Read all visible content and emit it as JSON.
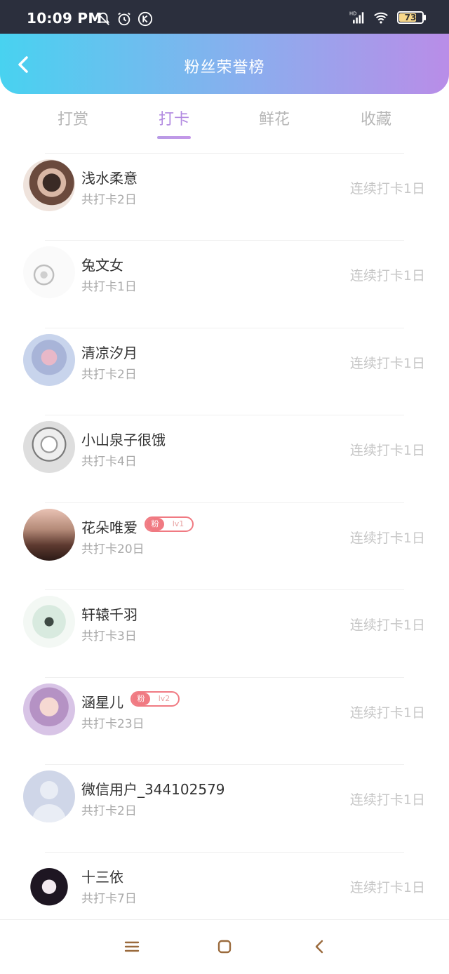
{
  "status_bar": {
    "time": "10:09 PM",
    "hd": "HD",
    "battery": "73"
  },
  "header": {
    "title": "粉丝荣誉榜"
  },
  "tabs": [
    {
      "label": "打赏"
    },
    {
      "label": "打卡"
    },
    {
      "label": "鲜花"
    },
    {
      "label": "收藏"
    }
  ],
  "active_tab": 1,
  "rows": [
    {
      "name": "浅水柔意",
      "count": "共打卡2日",
      "streak": "连续打卡1日"
    },
    {
      "name": "兔文女",
      "count": "共打卡1日",
      "streak": "连续打卡1日"
    },
    {
      "name": "清凉汐月",
      "count": "共打卡2日",
      "streak": "连续打卡1日"
    },
    {
      "name": "小山泉子很饿",
      "count": "共打卡4日",
      "streak": "连续打卡1日"
    },
    {
      "name": "花朵唯爱",
      "count": "共打卡20日",
      "streak": "连续打卡1日",
      "badge": {
        "label": "粉",
        "level": "lv1"
      }
    },
    {
      "name": "轩辕千羽",
      "count": "共打卡3日",
      "streak": "连续打卡1日"
    },
    {
      "name": "涵星儿",
      "count": "共打卡23日",
      "streak": "连续打卡1日",
      "badge": {
        "label": "粉",
        "level": "lv2"
      }
    },
    {
      "name": "微信用户_344102579",
      "count": "共打卡2日",
      "streak": "连续打卡1日"
    },
    {
      "name": "十三依",
      "count": "共打卡7日",
      "streak": "连续打卡1日"
    }
  ],
  "colors": {
    "accent": "#b28ae0",
    "badge": "#f07a82",
    "header_start": "#48d2f0",
    "header_end": "#b98de8"
  },
  "icons": [
    "back-icon",
    "mute-icon",
    "alarm-icon",
    "k-icon",
    "signal-icon",
    "wifi-icon",
    "battery-icon",
    "menu-icon",
    "home-icon",
    "back-nav-icon"
  ]
}
